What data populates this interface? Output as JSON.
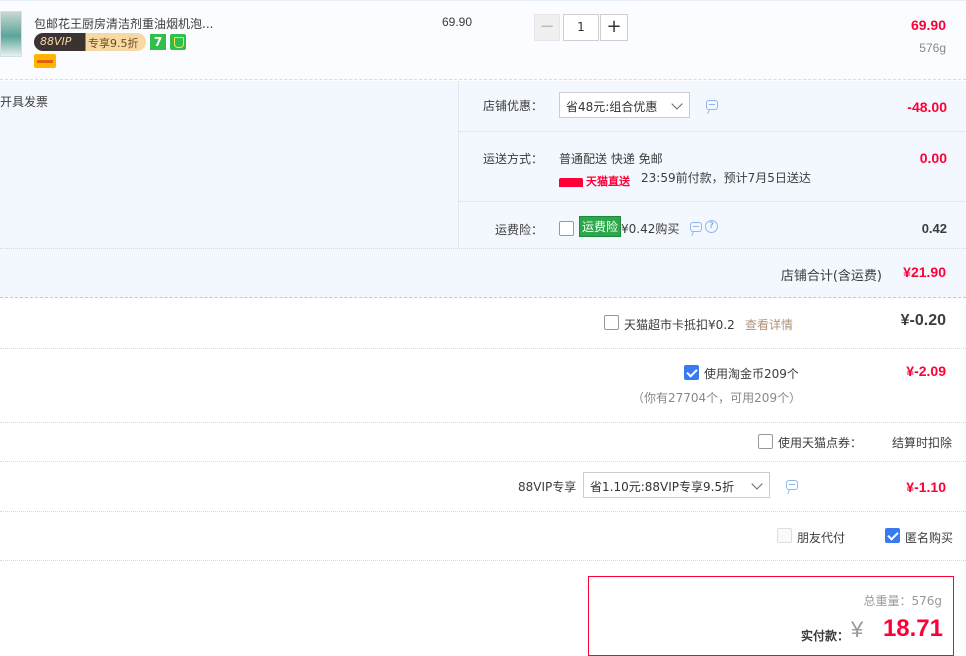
{
  "product": {
    "title": "包邮花王厨房清洁剂重油烟机泡...",
    "vip_tag": "88VIP",
    "vip_discount": "专享9.5折",
    "seven_icon_text": "7",
    "unit_price": "69.90",
    "quantity": "1",
    "minus_label": "−",
    "plus_label": "+",
    "total": "69.90",
    "weight": "576g"
  },
  "store": {
    "invoice_label": "开具发票",
    "discount_label": "店铺优惠：",
    "discount_select": "省48元:组合优惠",
    "discount_amount": "-48.00",
    "shipping_label": "运送方式：",
    "shipping_method": "普通配送 快递 免邮",
    "tmall_direct": "天猫直送",
    "shipping_note": "23:59前付款，预计7月5日送达",
    "shipping_amount": "0.00",
    "insurance_label": "运费险：",
    "insurance_badge": "运费险",
    "insurance_price": "¥0.42购买",
    "insurance_amount": "0.42",
    "help_icon_text": "?",
    "total_label": "店铺合计(含运费)",
    "total_amount": "¥21.90"
  },
  "deductions": {
    "supermarket_card_label": "天猫超市卡抵扣¥0.2",
    "supermarket_card_link": "查看详情",
    "supermarket_card_amount": "¥-0.20",
    "supermarket_card_checked": false,
    "taojinbi_label": "使用淘金币209个",
    "taojinbi_note": "（你有27704个，可用209个）",
    "taojinbi_amount": "¥-2.09",
    "taojinbi_checked": true,
    "tmall_points_label": "使用天猫点券：",
    "tmall_points_note": "结算时扣除",
    "tmall_points_checked": false,
    "vip_label": "88VIP专享",
    "vip_select": "省1.10元:88VIP专享9.5折",
    "vip_amount": "¥-1.10"
  },
  "payment": {
    "friend_pay_label": "朋友代付",
    "friend_pay_checked": false,
    "anonymous_label": "匿名购买",
    "anonymous_checked": true,
    "total_weight_label": "总重量：576g",
    "actual_pay_label": "实付款：",
    "currency_symbol": "¥",
    "actual_pay_amount": "18.71"
  },
  "colors": {
    "price_red": "#ff0036",
    "row_blue": "#f3f7fe",
    "checkbox_blue": "#3a7af0",
    "insurance_green": "#2aa84a"
  }
}
